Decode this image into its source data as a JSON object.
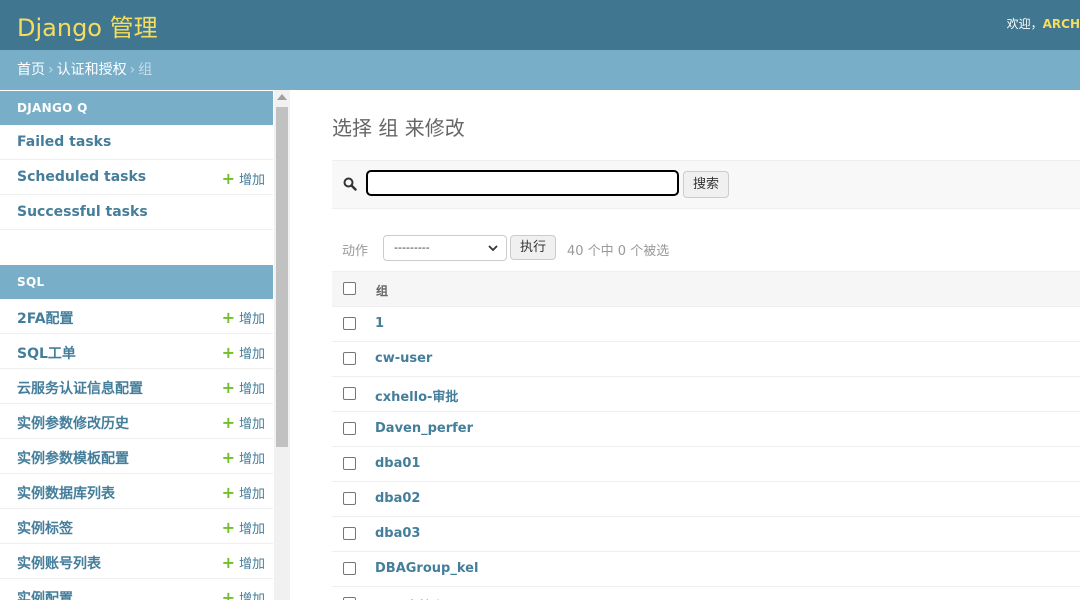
{
  "header": {
    "branding": "Django 管理",
    "welcome": "欢迎，",
    "username": "ARCH"
  },
  "breadcrumbs": {
    "home": "首页",
    "app": "认证和授权",
    "current": "组",
    "separator": "›"
  },
  "sidebar": {
    "modules": [
      {
        "caption": "DJANGO Q",
        "items": [
          {
            "label": "Failed tasks",
            "add": ""
          },
          {
            "label": "Scheduled tasks",
            "add": "增加"
          },
          {
            "label": "Successful tasks",
            "add": ""
          }
        ]
      },
      {
        "caption": "SQL",
        "items": [
          {
            "label": "2FA配置",
            "add": "增加"
          },
          {
            "label": "SQL工单",
            "add": "增加"
          },
          {
            "label": "云服务认证信息配置",
            "add": "增加"
          },
          {
            "label": "实例参数修改历史",
            "add": "增加"
          },
          {
            "label": "实例参数模板配置",
            "add": "增加"
          },
          {
            "label": "实例数据库列表",
            "add": "增加"
          },
          {
            "label": "实例标签",
            "add": "增加"
          },
          {
            "label": "实例账号列表",
            "add": "增加"
          },
          {
            "label": "实例配置",
            "add": "增加"
          }
        ]
      }
    ]
  },
  "content": {
    "title": "选择 组 来修改",
    "search": {
      "value": "",
      "button": "搜索"
    },
    "actions": {
      "label": "动作",
      "selected": "---------",
      "run": "执行",
      "counter": "40 个中 0 个被选"
    },
    "table": {
      "column": "组",
      "rows": [
        "1",
        "cw-user",
        "cxhello-审批",
        "Daven_perfer",
        "dba01",
        "dba02",
        "dba03",
        "DBAGroup_kel",
        "DBA审核岗"
      ]
    }
  },
  "colors": {
    "header_bg": "#417690",
    "branding": "#f5dd5d",
    "breadcrumb_bg": "#79aec8",
    "link": "#447e9b",
    "add_plus": "#70bf2b"
  }
}
